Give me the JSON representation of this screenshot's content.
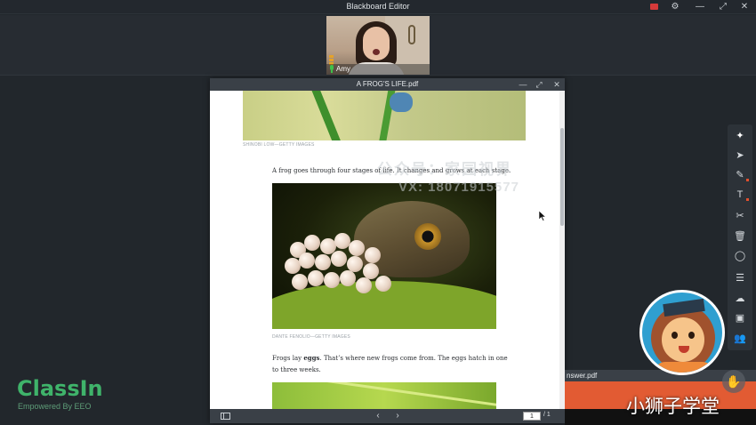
{
  "app": {
    "title": "Blackboard Editor"
  },
  "window_controls": {
    "gear": "⚙",
    "minimize": "—",
    "maximize": "⤢",
    "close": "✕"
  },
  "video": {
    "name": "Amy"
  },
  "pdf": {
    "title": "A FROG'S LIFE.pdf",
    "caption_top": "SHINOBI LOW—GETTY IMAGES",
    "para1": "A frog goes through four stages of life. It changes and grows at each stage.",
    "caption_frog": "DANTE FENOLIO—GETTY IMAGES",
    "para2_pre": "Frogs lay ",
    "para2_bold": "eggs",
    "para2_post": ". That’s where new frogs come from. The eggs hatch in one",
    "para2_line2": "to three weeks.",
    "page_current": "1",
    "page_total": "/ 1",
    "prev": "‹",
    "next": "›"
  },
  "watermark": {
    "line1": "公众号：家园视界",
    "line2": "VX: 18071915577"
  },
  "toolbar": {
    "items": [
      {
        "name": "laser-pointer",
        "glyph": "✦"
      },
      {
        "name": "select",
        "glyph": "➤"
      },
      {
        "name": "pen",
        "glyph": "✎"
      },
      {
        "name": "text",
        "glyph": "T"
      },
      {
        "name": "scissors",
        "glyph": "✂"
      },
      {
        "name": "eraser",
        "glyph": "🗑"
      },
      {
        "name": "shapes",
        "glyph": "◯"
      },
      {
        "name": "chat",
        "glyph": "☰"
      },
      {
        "name": "cloud",
        "glyph": "☁"
      },
      {
        "name": "toolbox",
        "glyph": "▣"
      },
      {
        "name": "students",
        "glyph": "👥"
      }
    ]
  },
  "logo": {
    "name": "ClassIn",
    "tagline": "Empowered By EEO"
  },
  "answer": {
    "title": "nswer.pdf"
  },
  "brand": {
    "chinese": "小狮子学堂"
  },
  "colors": {
    "accent_green": "#3fb36a",
    "record_red": "#d63a3a",
    "answer_orange": "#e25b33"
  }
}
